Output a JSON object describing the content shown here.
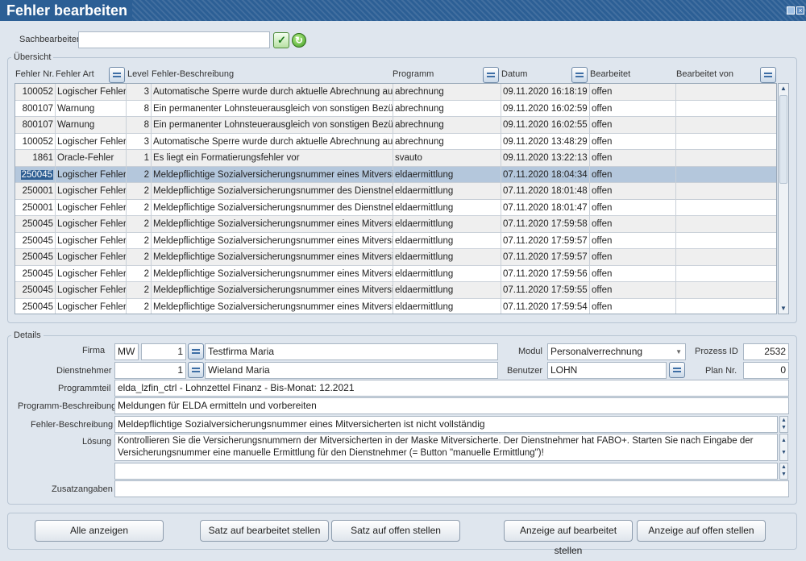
{
  "window": {
    "title": "Fehler bearbeiten"
  },
  "search": {
    "label": "Sachbearbeiter",
    "value": ""
  },
  "overview": {
    "legend": "Übersicht",
    "columns": {
      "nr": "Fehler Nr.",
      "art": "Fehler Art",
      "level": "Level",
      "beschreibung": "Fehler-Beschreibung",
      "programm": "Programm",
      "datum": "Datum",
      "bearbeitet": "Bearbeitet",
      "von": "Bearbeitet von"
    },
    "rows": [
      {
        "nr": "100052",
        "art": "Logischer Fehler",
        "level": "3",
        "beschreibung": "Automatische Sperre wurde durch aktuelle Abrechnung aufg",
        "programm": "abrechnung",
        "datum": "09.11.2020 16:18:19",
        "bearbeitet": "offen",
        "von": ""
      },
      {
        "nr": "800107",
        "art": "Warnung",
        "level": "8",
        "beschreibung": "Ein permanenter Lohnsteuerausgleich von sonstigen Bezüg",
        "programm": "abrechnung",
        "datum": "09.11.2020 16:02:59",
        "bearbeitet": "offen",
        "von": ""
      },
      {
        "nr": "800107",
        "art": "Warnung",
        "level": "8",
        "beschreibung": "Ein permanenter Lohnsteuerausgleich von sonstigen Bezüg",
        "programm": "abrechnung",
        "datum": "09.11.2020 16:02:55",
        "bearbeitet": "offen",
        "von": ""
      },
      {
        "nr": "100052",
        "art": "Logischer Fehler",
        "level": "3",
        "beschreibung": "Automatische Sperre wurde durch aktuelle Abrechnung aufg",
        "programm": "abrechnung",
        "datum": "09.11.2020 13:48:29",
        "bearbeitet": "offen",
        "von": ""
      },
      {
        "nr": "1861",
        "art": "Oracle-Fehler",
        "level": "1",
        "beschreibung": "Es liegt ein Formatierungsfehler vor",
        "programm": "svauto",
        "datum": "09.11.2020 13:22:13",
        "bearbeitet": "offen",
        "von": ""
      },
      {
        "nr": "250045",
        "art": "Logischer Fehler",
        "level": "2",
        "beschreibung": "Meldepflichtige Sozialversicherungsnummer eines Mitversich",
        "programm": "eldaermittlung",
        "datum": "07.11.2020 18:04:34",
        "bearbeitet": "offen",
        "von": ""
      },
      {
        "nr": "250001",
        "art": "Logischer Fehler",
        "level": "2",
        "beschreibung": "Meldepflichtige Sozialversicherungsnummer des Dienstnehm",
        "programm": "eldaermittlung",
        "datum": "07.11.2020 18:01:48",
        "bearbeitet": "offen",
        "von": ""
      },
      {
        "nr": "250001",
        "art": "Logischer Fehler",
        "level": "2",
        "beschreibung": "Meldepflichtige Sozialversicherungsnummer des Dienstnehm",
        "programm": "eldaermittlung",
        "datum": "07.11.2020 18:01:47",
        "bearbeitet": "offen",
        "von": ""
      },
      {
        "nr": "250045",
        "art": "Logischer Fehler",
        "level": "2",
        "beschreibung": "Meldepflichtige Sozialversicherungsnummer eines Mitversich",
        "programm": "eldaermittlung",
        "datum": "07.11.2020 17:59:58",
        "bearbeitet": "offen",
        "von": ""
      },
      {
        "nr": "250045",
        "art": "Logischer Fehler",
        "level": "2",
        "beschreibung": "Meldepflichtige Sozialversicherungsnummer eines Mitversich",
        "programm": "eldaermittlung",
        "datum": "07.11.2020 17:59:57",
        "bearbeitet": "offen",
        "von": ""
      },
      {
        "nr": "250045",
        "art": "Logischer Fehler",
        "level": "2",
        "beschreibung": "Meldepflichtige Sozialversicherungsnummer eines Mitversich",
        "programm": "eldaermittlung",
        "datum": "07.11.2020 17:59:57",
        "bearbeitet": "offen",
        "von": ""
      },
      {
        "nr": "250045",
        "art": "Logischer Fehler",
        "level": "2",
        "beschreibung": "Meldepflichtige Sozialversicherungsnummer eines Mitversich",
        "programm": "eldaermittlung",
        "datum": "07.11.2020 17:59:56",
        "bearbeitet": "offen",
        "von": ""
      },
      {
        "nr": "250045",
        "art": "Logischer Fehler",
        "level": "2",
        "beschreibung": "Meldepflichtige Sozialversicherungsnummer eines Mitversich",
        "programm": "eldaermittlung",
        "datum": "07.11.2020 17:59:55",
        "bearbeitet": "offen",
        "von": ""
      },
      {
        "nr": "250045",
        "art": "Logischer Fehler",
        "level": "2",
        "beschreibung": "Meldepflichtige Sozialversicherungsnummer eines Mitversich",
        "programm": "eldaermittlung",
        "datum": "07.11.2020 17:59:54",
        "bearbeitet": "offen",
        "von": ""
      }
    ],
    "selected_row": 5
  },
  "details": {
    "legend": "Details",
    "firma": {
      "label": "Firma",
      "code": "MW",
      "nr": "1",
      "name": "Testfirma Maria"
    },
    "modul": {
      "label": "Modul",
      "value": "Personalverrechnung"
    },
    "prozess_id": {
      "label": "Prozess ID",
      "value": "2532"
    },
    "dienstnehmer": {
      "label": "Dienstnehmer",
      "nr": "1",
      "name": "Wieland Maria"
    },
    "benutzer": {
      "label": "Benutzer",
      "value": "LOHN"
    },
    "plan_nr": {
      "label": "Plan Nr.",
      "value": "0"
    },
    "programmteil": {
      "label": "Programmteil",
      "value": "elda_lzfin_ctrl - Lohnzettel Finanz - Bis-Monat: 12.2021"
    },
    "programm_beschreibung": {
      "label": "Programm-Beschreibung",
      "value": "Meldungen für ELDA ermitteln und vorbereiten"
    },
    "fehler_beschreibung": {
      "label": "Fehler-Beschreibung",
      "value": "Meldepflichtige Sozialversicherungsnummer eines Mitversicherten ist nicht vollständig"
    },
    "loesung": {
      "label": "Lösung",
      "line1": "Kontrollieren Sie die Versicherungsnummern der Mitversicherten in der Maske Mitversicherte. Der Dienstnehmer hat FABO+. Starten Sie nach Eingabe der",
      "line2": "Versicherungsnummer eine manuelle Ermittlung für den Dienstnehmer (= Button \"manuelle Ermittlung\")!"
    },
    "zusatzangaben": {
      "label": "Zusatzangaben",
      "value": ""
    }
  },
  "buttons": {
    "alle": "Alle anzeigen",
    "satz_bearbeitet": "Satz auf bearbeitet stellen",
    "satz_offen": "Satz auf offen stellen",
    "anzeige_bearbeitet": "Anzeige auf bearbeitet stellen",
    "anzeige_offen": "Anzeige auf offen stellen"
  },
  "colors": {
    "titlebar": "#2c5f95",
    "selection": "#b4c7dc",
    "background": "#dfe6ee"
  }
}
